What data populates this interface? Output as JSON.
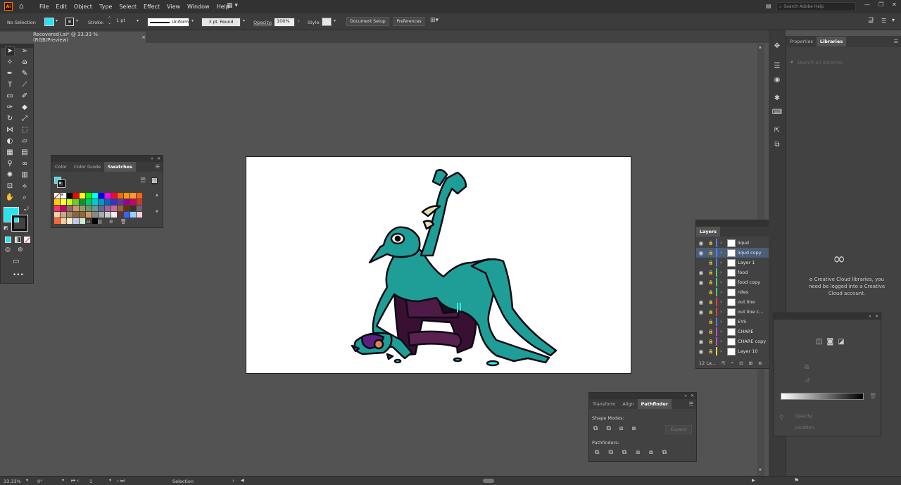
{
  "app": {
    "logo_text": "Ai"
  },
  "menu": [
    "File",
    "Edit",
    "Object",
    "Type",
    "Select",
    "Effect",
    "View",
    "Window",
    "Help"
  ],
  "search": {
    "placeholder": "Search Adobe Help"
  },
  "control": {
    "selection_status": "No Selection",
    "stroke_label": "Stroke:",
    "stroke_value": "1 pt",
    "profile_value": "Uniform",
    "brush_value": "3 pt. Round",
    "opacity_label": "Opacity:",
    "opacity_value": "100%",
    "style_label": "Style:",
    "document_setup": "Document Setup",
    "preferences": "Preferences",
    "fill_color": "#29e4f0"
  },
  "document": {
    "tab_title": "Recovered).ai* @ 33.33 % (RGB/Preview)",
    "close": "×"
  },
  "swatches_panel": {
    "tabs": [
      "Color",
      "Color Guide",
      "Swatches"
    ],
    "active_tab": "Swatches",
    "swatch_colors": [
      [
        "#ffffff",
        "#ffffff",
        "#000000",
        "#ff0000",
        "#ffff00",
        "#00ff00",
        "#00ffff",
        "#0000ff",
        "#ff00ff",
        "#ff0033",
        "#ff6600",
        "#ff9900",
        "#ff9933",
        "#ff6600"
      ],
      [
        "#ffcc00",
        "#ffff33",
        "#ccff00",
        "#66cc33",
        "#009933",
        "#00cc66",
        "#00cccc",
        "#0099cc",
        "#0066cc",
        "#3333cc",
        "#663399",
        "#990099",
        "#cc0066",
        "#cc3333"
      ],
      [
        "#ff3366",
        "#cc0066",
        "#996666",
        "#cc9966",
        "#999966",
        "#669966",
        "#669999",
        "#666699",
        "#996699",
        "#cc6699",
        "#996633",
        "#663300",
        "#333333",
        "#666666"
      ],
      [
        "#ffccaa",
        "#ccaa88",
        "#aa8866",
        "#886644",
        "#996633",
        "#cc9966",
        "#888888",
        "#aaaaaa",
        "#cccccc",
        "#eeeeee",
        "#663333",
        "#3366ff",
        "#99ccff",
        "#ffccdd"
      ],
      [
        "#ff6633",
        "#ffcc99",
        "#ffeecc",
        "#ccccff",
        "#cceecc",
        "#333333",
        "#000000"
      ]
    ]
  },
  "layers_panel": {
    "title": "Layers",
    "count": "12 La...",
    "layers": [
      {
        "name": "liqud",
        "color": "#4f7fff",
        "visible": true,
        "selected": false
      },
      {
        "name": "liqud copy",
        "color": "#4f7fff",
        "visible": true,
        "selected": true
      },
      {
        "name": "Layer 1",
        "color": "#4f7fff",
        "visible": false,
        "selected": false
      },
      {
        "name": "food",
        "color": "#50c878",
        "visible": true,
        "selected": false
      },
      {
        "name": "food copy",
        "color": "#50c878",
        "visible": true,
        "selected": false
      },
      {
        "name": "niles",
        "color": "#50c878",
        "visible": false,
        "selected": false
      },
      {
        "name": "out line",
        "color": "#e04040",
        "visible": true,
        "selected": false
      },
      {
        "name": "out line c...",
        "color": "#e04040",
        "visible": true,
        "selected": false
      },
      {
        "name": "EYS",
        "color": "#4f7fff",
        "visible": false,
        "selected": false
      },
      {
        "name": "CHARE",
        "color": "#c050c0",
        "visible": true,
        "selected": false
      },
      {
        "name": "CHARE copy",
        "color": "#c050c0",
        "visible": true,
        "selected": false
      },
      {
        "name": "Layer 10",
        "color": "#e0e040",
        "visible": true,
        "selected": false
      }
    ]
  },
  "pathfinder_panel": {
    "tabs": [
      "Transform",
      "Align",
      "Pathfinder"
    ],
    "active_tab": "Pathfinder",
    "shape_modes_label": "Shape Modes:",
    "expand_label": "Expand",
    "pathfinders_label": "Pathfinders:"
  },
  "right_panel": {
    "tabs": [
      "Properties",
      "Libraries"
    ],
    "active_tab": "Libraries",
    "search_placeholder": "Search all libraries",
    "message": "e Creative Cloud libraries, you need be logged into a Creative Cloud account.",
    "opacity_label": "Opacity",
    "location_label": "Location"
  },
  "status": {
    "zoom": "33.33%",
    "rotation": "0°",
    "artboard": "1",
    "tool": "Selection"
  }
}
